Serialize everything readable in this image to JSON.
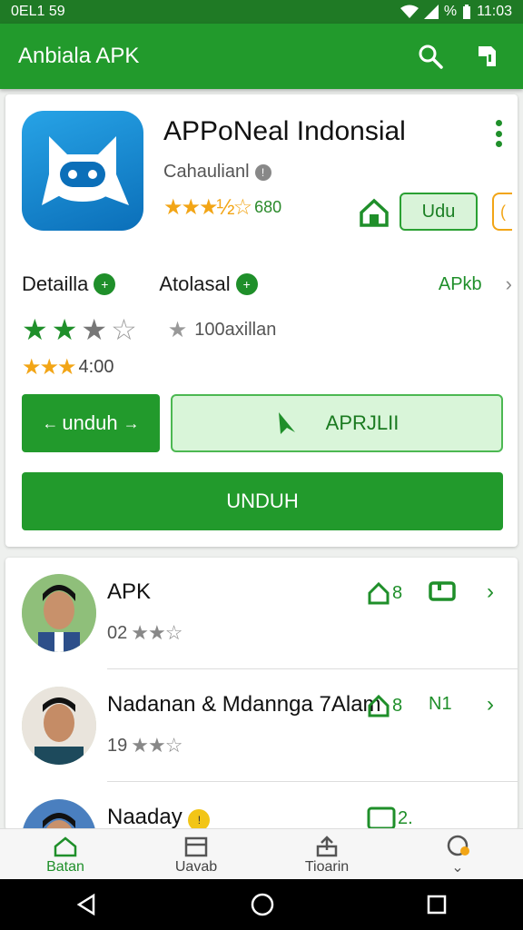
{
  "status": {
    "left": "0EL1 59",
    "right": "11:03",
    "battery_text": "%"
  },
  "appbar": {
    "title": "Anbiala APK"
  },
  "app": {
    "title": "APPoNeal Indonsial",
    "developer": "Cahaulianl",
    "rating_text": "680",
    "install_short": "Udu"
  },
  "details": {
    "label": "Detailla",
    "alt_label": "Atolasal",
    "apk_link": "APkb",
    "downloads": "100axillan",
    "rating_value": "4:00"
  },
  "buttons": {
    "unduh_small": "unduh",
    "aprili": "APRJLII",
    "unduh_big": "UNDUH"
  },
  "list": [
    {
      "name": "APK",
      "count": "02"
    },
    {
      "name": "Nadanan & Mdannga 7Alam",
      "count": "19",
      "a1_num": "8",
      "a2_text": "N1"
    },
    {
      "name": "Naaday",
      "count": "",
      "a2_text": "2."
    }
  ],
  "list_a1_first": "8",
  "bottom_nav": [
    {
      "label": "Batan"
    },
    {
      "label": "Uavab"
    },
    {
      "label": "Tioarin"
    }
  ],
  "colors": {
    "primary": "#229a2c",
    "accent": "#f2a516",
    "light": "#d9f5d9"
  }
}
